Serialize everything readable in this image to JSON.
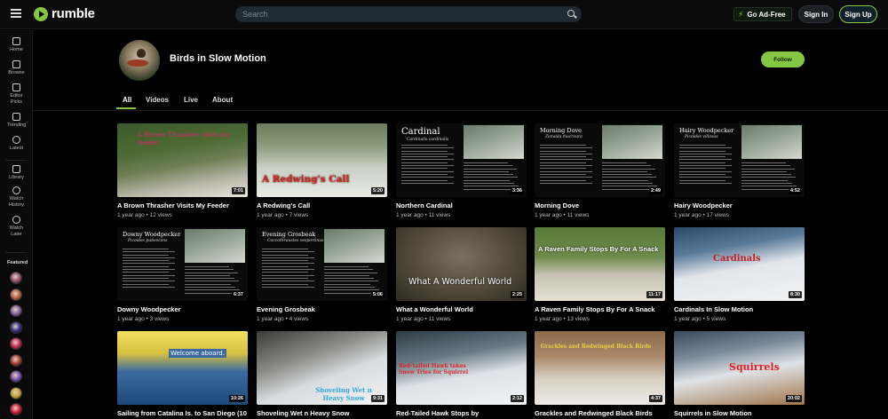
{
  "brand": {
    "name": "rumble",
    "accent": "#85c742"
  },
  "search": {
    "placeholder": "Search"
  },
  "header": {
    "go_ad_free": "Go Ad-Free",
    "sign_in": "Sign In",
    "sign_up": "Sign Up"
  },
  "sidebar": {
    "items": [
      {
        "label": "Home",
        "icon": "home-icon"
      },
      {
        "label": "Browse",
        "icon": "browse-icon"
      },
      {
        "label": "Editor Picks",
        "icon": "editor-picks-icon"
      },
      {
        "label": "Trending",
        "icon": "trending-icon"
      },
      {
        "label": "Latest",
        "icon": "clock-icon"
      },
      {
        "label": "Library",
        "icon": "library-icon"
      },
      {
        "label": "Watch History",
        "icon": "history-icon"
      },
      {
        "label": "Watch Later",
        "icon": "watch-later-icon"
      }
    ],
    "featured_title": "Featured",
    "featured_colors": [
      "#8a4a6a",
      "#b05a3a",
      "#7a5a9a",
      "#2a2a7a",
      "#c02050",
      "#9a3a2a",
      "#6a4aaa",
      "#c0a030",
      "#d01030"
    ]
  },
  "channel": {
    "name": "Birds in Slow Motion",
    "follow_label": "Follow"
  },
  "tabs": [
    "All",
    "Videos",
    "Live",
    "About"
  ],
  "videos": [
    {
      "title": "A Brown Thrasher Visits My Feeder",
      "meta": "1 year ago • 12 views",
      "duration": "7:01",
      "overlay": "A Brown Thrasher visits my feeder"
    },
    {
      "title": "A Redwing's Call",
      "meta": "1 year ago • 7 views",
      "duration": "5:20",
      "overlay": "A Redwing's Call"
    },
    {
      "title": "Northern Cardinal",
      "meta": "1 year ago • 11 views",
      "duration": "3:36",
      "doc_title": "Cardinal",
      "doc_sub": "Cardinalis cardinalis"
    },
    {
      "title": "Morning Dove",
      "meta": "1 year ago • 11 views",
      "duration": "2:49",
      "doc_title": "Morning Dove",
      "doc_sub": "Zenaida macroura"
    },
    {
      "title": "Hairy Woodpecker",
      "meta": "1 year ago • 17 views",
      "duration": "4:52",
      "doc_title": "Hairy Woodpecker",
      "doc_sub": "Picoides villosus"
    },
    {
      "title": "Downy Woodpecker",
      "meta": "1 year ago • 3 views",
      "duration": "6:37",
      "doc_title": "Downy Woodpecker",
      "doc_sub": "Picoides pubescens"
    },
    {
      "title": "Evening Grosbeak",
      "meta": "1 year ago • 4 views",
      "duration": "5:06",
      "doc_title": "Evening Grosbeak",
      "doc_sub": "Coccothraustes vespertinus"
    },
    {
      "title": "What a Wonderful World",
      "meta": "1 year ago • 11 views",
      "duration": "2:25",
      "overlay": "What A Wonderful World"
    },
    {
      "title": "A Raven Family Stops By For A Snack",
      "meta": "1 year ago • 13 views",
      "duration": "11:17",
      "overlay": "A Raven Family Stops By For A Snack"
    },
    {
      "title": "Cardinals In Slow Motion",
      "meta": "1 year ago • 5 views",
      "duration": "8:30",
      "overlay": "Cardinals"
    },
    {
      "title": "Sailing from Catalina Is. to San Diego (10",
      "meta": "",
      "duration": "10:26",
      "overlay": "Welcome aboard."
    },
    {
      "title": "Shoveling Wet n Heavy Snow",
      "meta": "",
      "duration": "9:31",
      "overlay": "Shoveling Wet n Heavy Snow"
    },
    {
      "title": "Red-Tailed Hawk Stops by",
      "meta": "",
      "duration": "2:12",
      "overlay": "Red-tailed Hawk takes Snow Tries for Squirrel"
    },
    {
      "title": "Grackles and Redwinged Black Birds",
      "meta": "",
      "duration": "4:37",
      "overlay": "Grackles and Redwinged Black Birds"
    },
    {
      "title": "Squirrels in Slow Motion",
      "meta": "",
      "duration": "20:02",
      "overlay": "Squirrels"
    }
  ]
}
